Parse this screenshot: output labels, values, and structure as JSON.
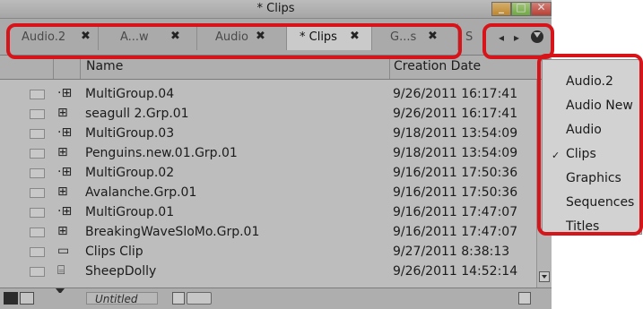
{
  "window": {
    "title": "* Clips",
    "controls": {
      "minimize_icon": "minimize-icon",
      "maximize_icon": "maximize-icon",
      "close_icon": "close-icon",
      "close_glyph": "✕"
    }
  },
  "tabs": [
    {
      "label": "Audio.2",
      "active": false
    },
    {
      "label": "A...w",
      "active": false
    },
    {
      "label": "Audio",
      "active": false
    },
    {
      "label": "* Clips",
      "active": true
    },
    {
      "label": "G...s",
      "active": false
    },
    {
      "label": "S",
      "active": false
    }
  ],
  "tab_close_glyph": "✖",
  "tab_nav": {
    "prev": "◂",
    "next": "▸",
    "menu_icon": "chevron-down-icon"
  },
  "columns": {
    "name": "Name",
    "date": "Creation Date"
  },
  "rows": [
    {
      "icon": "·⊞",
      "name": "MultiGroup.04",
      "date": "9/26/2011 16:17:41"
    },
    {
      "icon": "⊞",
      "name": "seagull 2.Grp.01",
      "date": "9/26/2011 16:17:41"
    },
    {
      "icon": "·⊞",
      "name": "MultiGroup.03",
      "date": "9/18/2011 13:54:09"
    },
    {
      "icon": "⊞",
      "name": "Penguins.new.01.Grp.01",
      "date": "9/18/2011 13:54:09"
    },
    {
      "icon": "·⊞",
      "name": "MultiGroup.02",
      "date": "9/16/2011 17:50:36"
    },
    {
      "icon": "⊞",
      "name": "Avalanche.Grp.01",
      "date": "9/16/2011 17:50:36"
    },
    {
      "icon": "·⊞",
      "name": "MultiGroup.01",
      "date": "9/16/2011 17:47:07"
    },
    {
      "icon": "⊞",
      "name": "BreakingWaveSloMo.Grp.01",
      "date": "9/16/2011 17:47:07"
    },
    {
      "icon": "▭",
      "name": "Clips Clip",
      "date": "9/27/2011 8:38:13"
    },
    {
      "icon": "⌸",
      "name": "SheepDolly",
      "date": "9/26/2011 14:52:14"
    }
  ],
  "bottom": {
    "view_label": "Untitled"
  },
  "dropdown": {
    "items": [
      {
        "label": "Audio.2",
        "checked": false
      },
      {
        "label": "Audio New",
        "checked": false
      },
      {
        "label": "Audio",
        "checked": false
      },
      {
        "label": "Clips",
        "checked": true
      },
      {
        "label": "Graphics",
        "checked": false
      },
      {
        "label": "Sequences",
        "checked": false
      },
      {
        "label": "Titles",
        "checked": false
      }
    ],
    "check_glyph": "✓"
  },
  "colors": {
    "highlight": "#d7141a",
    "background": "#d8d8d8",
    "active_tab": "#e6e6e6"
  }
}
